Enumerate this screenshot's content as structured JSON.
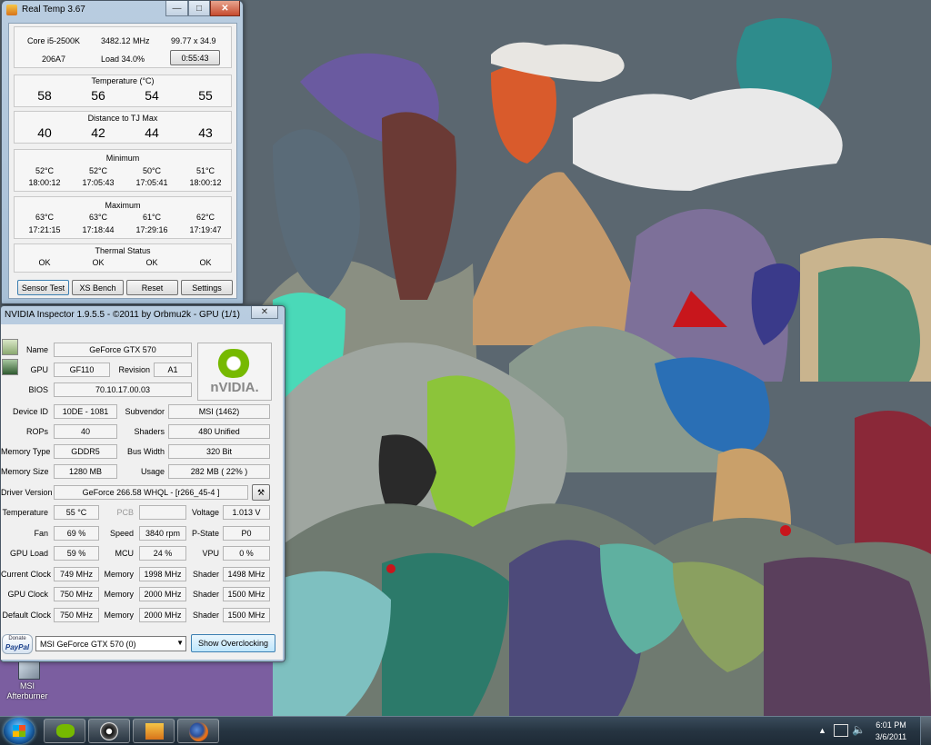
{
  "realtemp": {
    "title": "Real Temp 3.67",
    "cpu": "Core i5-2500K",
    "mhz": "3482.12 MHz",
    "mult": "99.77 x 34.9",
    "code": "206A7",
    "load": "Load  34.0%",
    "time": "0:55:43",
    "temperature_header": "Temperature (°C)",
    "temps": [
      "58",
      "56",
      "54",
      "55"
    ],
    "distance_header": "Distance to TJ Max",
    "distances": [
      "40",
      "42",
      "44",
      "43"
    ],
    "minimum_header": "Minimum",
    "min_temps": [
      "52°C",
      "52°C",
      "50°C",
      "51°C"
    ],
    "min_times": [
      "18:00:12",
      "17:05:43",
      "17:05:41",
      "18:00:12"
    ],
    "maximum_header": "Maximum",
    "max_temps": [
      "63°C",
      "63°C",
      "61°C",
      "62°C"
    ],
    "max_times": [
      "17:21:15",
      "17:18:44",
      "17:29:16",
      "17:19:47"
    ],
    "thermal_header": "Thermal Status",
    "thermal": [
      "OK",
      "OK",
      "OK",
      "OK"
    ],
    "buttons": [
      "Sensor Test",
      "XS Bench",
      "Reset",
      "Settings"
    ]
  },
  "inspector": {
    "title": "NVIDIA Inspector 1.9.5.5 - ©2011 by Orbmu2k - GPU (1/1)",
    "labels": {
      "name": "Name",
      "gpu": "GPU",
      "revision": "Revision",
      "bios": "BIOS",
      "device_id": "Device ID",
      "subvendor": "Subvendor",
      "rops": "ROPs",
      "shaders": "Shaders",
      "memory_type": "Memory Type",
      "bus_width": "Bus Width",
      "memory_size": "Memory Size",
      "usage": "Usage",
      "driver_version": "Driver Version",
      "temperature": "Temperature",
      "pcb": "PCB",
      "voltage": "Voltage",
      "fan": "Fan",
      "speed": "Speed",
      "pstate": "P-State",
      "gpu_load": "GPU Load",
      "mcu": "MCU",
      "vpu": "VPU",
      "current_clock": "Current Clock",
      "gpu_clock": "GPU Clock",
      "default_clock": "Default Clock",
      "memory": "Memory",
      "shader": "Shader"
    },
    "values": {
      "name": "GeForce GTX 570",
      "gpu": "GF110",
      "revision": "A1",
      "bios": "70.10.17.00.03",
      "device_id": "10DE - 1081",
      "subvendor": "MSI (1462)",
      "rops": "40",
      "shaders": "480 Unified",
      "memory_type": "GDDR5",
      "bus_width": "320 Bit",
      "memory_size": "1280 MB",
      "usage": "282 MB ( 22% )",
      "driver_version": "GeForce 266.58 WHQL - [r266_45-4 ]",
      "temperature": "55 °C",
      "pcb": "",
      "voltage": "1.013 V",
      "fan": "69 %",
      "speed": "3840 rpm",
      "pstate": "P0",
      "gpu_load": "59 %",
      "mcu": "24 %",
      "vpu": "0 %",
      "current_clock": "749 MHz",
      "current_memory": "1998 MHz",
      "current_shader": "1498 MHz",
      "gpu_clock": "750 MHz",
      "gpu_memory": "2000 MHz",
      "gpu_shader": "1500 MHz",
      "default_clock": "750 MHz",
      "default_memory": "2000 MHz",
      "default_shader": "1500 MHz"
    },
    "nvidia_logo_text": "nVIDIA.",
    "donate_top": "Donate",
    "donate_bottom": "PayPal",
    "gpu_select": "MSI GeForce GTX 570 (0)",
    "overclock_button": "Show Overclocking"
  },
  "desktop": {
    "icon_label_1": "MSI",
    "icon_label_2": "Afterburner"
  },
  "taskbar": {
    "time": "6:01 PM",
    "date": "3/6/2011"
  }
}
